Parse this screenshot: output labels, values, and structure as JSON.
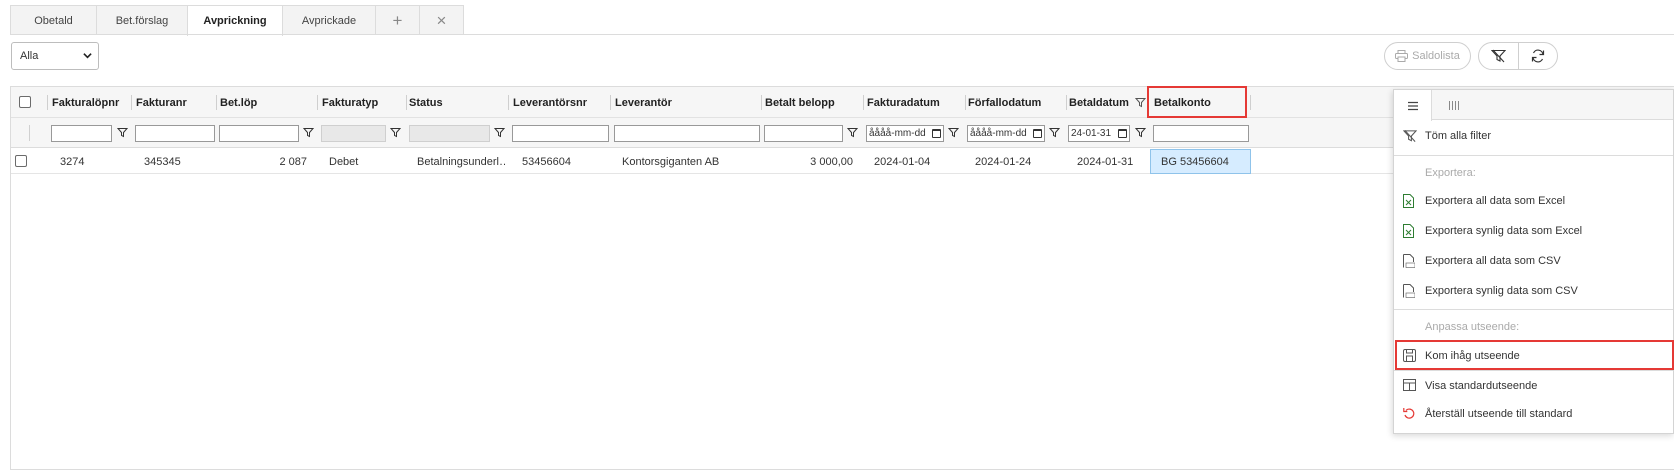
{
  "tabs": [
    {
      "label": "Obetald"
    },
    {
      "label": "Bet.förslag"
    },
    {
      "label": "Avprickning"
    },
    {
      "label": "Avprickade"
    }
  ],
  "tab_add_glyph": "+",
  "tab_close_glyph": "×",
  "filter_select": {
    "value": "Alla"
  },
  "toolbar": {
    "saldolista_label": "Saldolista"
  },
  "columns": [
    {
      "label": "Fakturalöpnr"
    },
    {
      "label": "Fakturanr"
    },
    {
      "label": "Bet.löp"
    },
    {
      "label": "Fakturatyp"
    },
    {
      "label": "Status"
    },
    {
      "label": "Leverantörsnr"
    },
    {
      "label": "Leverantör"
    },
    {
      "label": "Betalt belopp"
    },
    {
      "label": "Fakturadatum"
    },
    {
      "label": "Förfallodatum"
    },
    {
      "label": "Betaldatum"
    },
    {
      "label": "Betalkonto"
    }
  ],
  "filters": {
    "fakturadatum": "åååå-mm-dd",
    "forfallodatum": "åååå-mm-dd",
    "betaldatum": "24-01-31"
  },
  "rows": [
    {
      "fakturalopnr": "3274",
      "fakturanr": "345345",
      "betlop": "2 087",
      "fakturatyp": "Debet",
      "status": "Betalningsunderl…",
      "leverantorsnr": "53456604",
      "leverantor": "Kontorsgiganten AB",
      "betalt_belopp": "3 000,00",
      "fakturadatum": "2024-01-04",
      "forfallodatum": "2024-01-24",
      "betaldatum": "2024-01-31",
      "betalkonto": "BG 53456604"
    }
  ],
  "menu": {
    "items": [
      {
        "label": "Töm alla filter",
        "icon": "clear-filter-icon"
      },
      {
        "label": "Exportera:",
        "heading": true
      },
      {
        "label": "Exportera all data som Excel",
        "icon": "excel-file-icon"
      },
      {
        "label": "Exportera synlig data som Excel",
        "icon": "excel-file-icon"
      },
      {
        "label": "Exportera all data som CSV",
        "icon": "csv-file-icon"
      },
      {
        "label": "Exportera synlig data som CSV",
        "icon": "csv-file-icon"
      },
      {
        "label": "Anpassa utseende:",
        "heading": true
      },
      {
        "label": "Kom ihåg utseende",
        "icon": "save-icon"
      },
      {
        "label": "Visa standardutseende",
        "icon": "layout-icon"
      },
      {
        "label": "Återställ utseende till standard",
        "icon": "undo-icon"
      }
    ]
  },
  "colors": {
    "highlight": "#e53935",
    "selected_cell": "#d6ecff",
    "excel_green": "#2e7d32",
    "reset_red": "#e53935"
  }
}
